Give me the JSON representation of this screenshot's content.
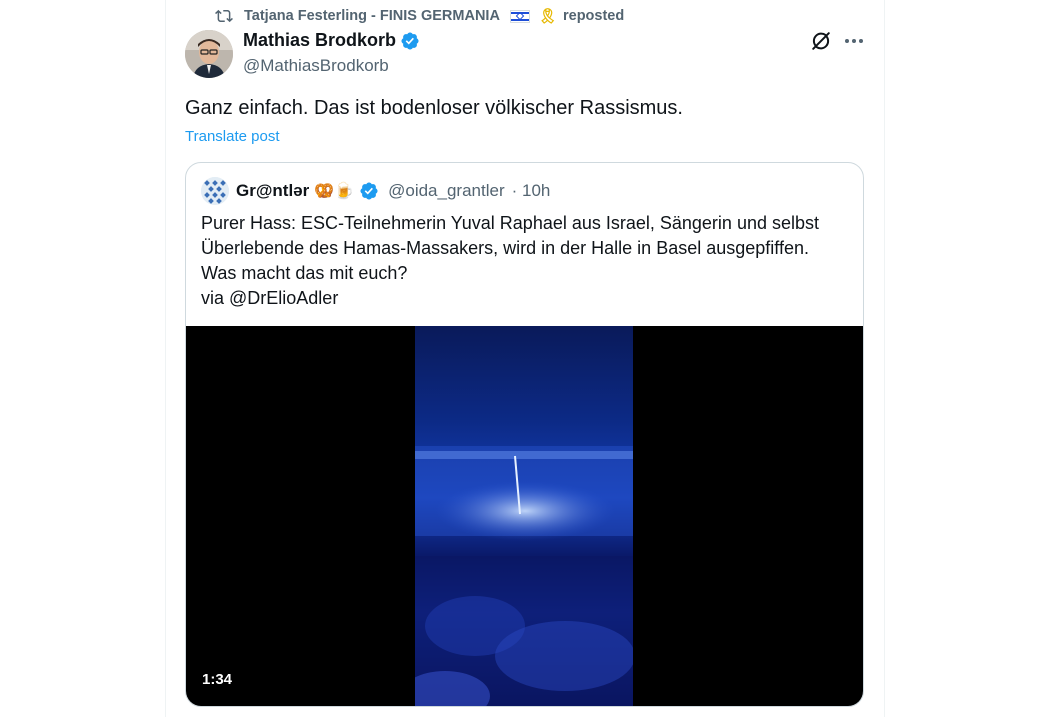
{
  "repost": {
    "label": "Tatjana Festerling - FINIS GERMANIA",
    "suffix": "reposted",
    "icons": [
      "repost-icon",
      "israel-flag-emoji",
      "yellow-ribbon-emoji"
    ]
  },
  "post": {
    "author_name": "Mathias Brodkorb",
    "author_handle": "@MathiasBrodkorb",
    "text": "Ganz einfach. Das ist bodenloser völkischer Rassismus.",
    "translate_label": "Translate post"
  },
  "quote": {
    "author_name": "Gr@ntlər",
    "author_emojis": "🥨🍺",
    "author_handle": "@oida_grantler",
    "time": "· 10h",
    "lines": [
      "Purer Hass: ESC-Teilnehmerin Yuval Raphael aus Israel, Sängerin und selbst",
      "Überlebende des Hamas-Massakers, wird in der Halle in Basel ausgepfiffen.",
      "Was macht das mit euch?",
      "via @DrElioAdler"
    ],
    "video_duration": "1:34"
  },
  "colors": {
    "text_primary": "#0f1419",
    "text_secondary": "#536471",
    "accent": "#1d9bf0",
    "border": "#cfd9de"
  }
}
